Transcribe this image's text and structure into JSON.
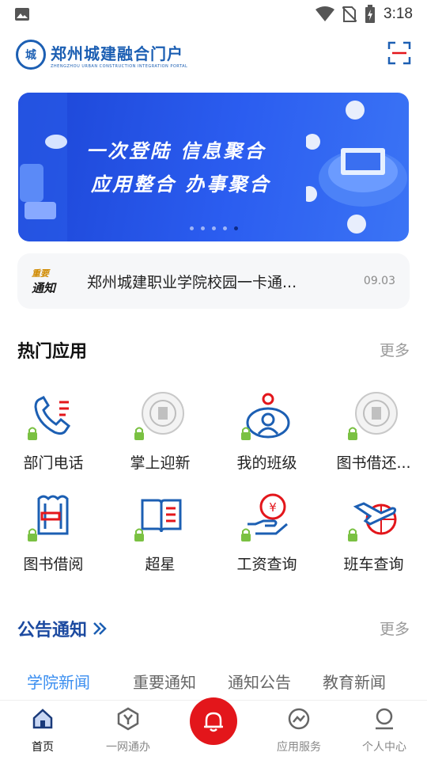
{
  "status": {
    "time": "3:18"
  },
  "header": {
    "logo_cn": "郑州城建融合门户",
    "logo_en": "ZHENGZHOU URBAN CONSTRUCTION INTEGRATION PORTAL",
    "logo_mark": "城"
  },
  "banner": {
    "line1": "一次登陆 信息聚合",
    "line2": "应用整合 办事聚合",
    "dots": 5,
    "active_dot": 4
  },
  "notice": {
    "badge_top": "重要",
    "badge_bottom": "通知",
    "text": "郑州城建职业学院校园一卡通...",
    "date": "09.03"
  },
  "hot_apps": {
    "title": "热门应用",
    "more": "更多",
    "items": [
      {
        "label": "部门电话",
        "icon": "phone-icon"
      },
      {
        "label": "掌上迎新",
        "icon": "school-logo-icon"
      },
      {
        "label": "我的班级",
        "icon": "class-icon"
      },
      {
        "label": "图书借还...",
        "icon": "school-logo-icon"
      },
      {
        "label": "图书借阅",
        "icon": "book-borrow-icon"
      },
      {
        "label": "超星",
        "icon": "open-book-icon"
      },
      {
        "label": "工资查询",
        "icon": "salary-icon"
      },
      {
        "label": "班车查询",
        "icon": "flight-globe-icon"
      }
    ]
  },
  "announcements": {
    "title": "公告通知",
    "more": "更多",
    "tabs": [
      "学院新闻",
      "重要通知",
      "通知公告",
      "教育新闻"
    ],
    "active_tab": 0
  },
  "nav": {
    "items": [
      "首页",
      "一网通办",
      "",
      "应用服务",
      "个人中心"
    ],
    "active": 0
  },
  "colors": {
    "brand": "#1c5fb3",
    "accent_red": "#e3161b",
    "tab_active": "#3a8ef0",
    "lock_green": "#7ac142"
  }
}
